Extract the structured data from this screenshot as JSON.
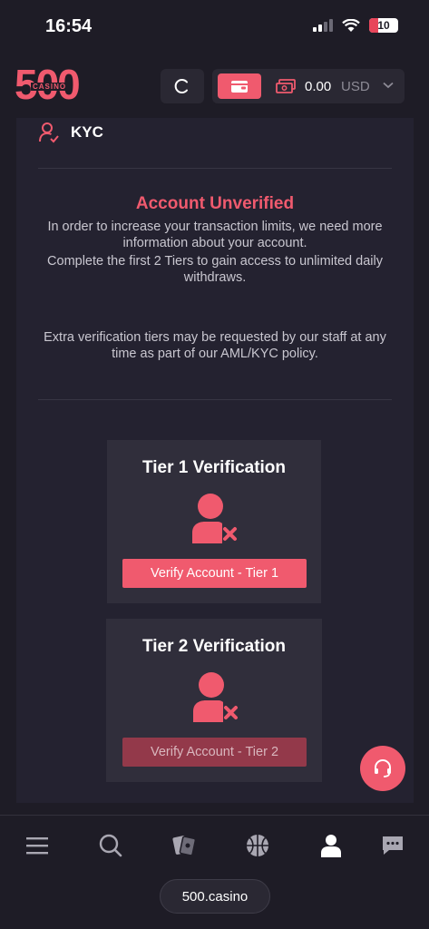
{
  "status": {
    "time": "16:54",
    "battery": "10"
  },
  "header": {
    "logo_number": "500",
    "logo_sub": "CASINO",
    "refresh_label": "C",
    "balance": "0.00",
    "currency": "USD"
  },
  "kyc": {
    "section_title": "KYC",
    "status_title": "Account Unverified",
    "intro_text": "In order to increase your transaction limits, we need more information about your account.",
    "tiers_text": "Complete the first 2 Tiers to gain access to unlimited daily withdraws.",
    "extra_text": "Extra verification tiers may be requested by our staff at any time as part of our AML/KYC policy."
  },
  "tiers": [
    {
      "title": "Tier 1 Verification",
      "button": "Verify Account - Tier 1",
      "enabled": true
    },
    {
      "title": "Tier 2 Verification",
      "button": "Verify Account - Tier 2",
      "enabled": false
    }
  ],
  "bottom": {
    "domain": "500.casino"
  },
  "colors": {
    "accent": "#f05a6e",
    "background": "#1e1c26",
    "card": "#302e3b"
  }
}
